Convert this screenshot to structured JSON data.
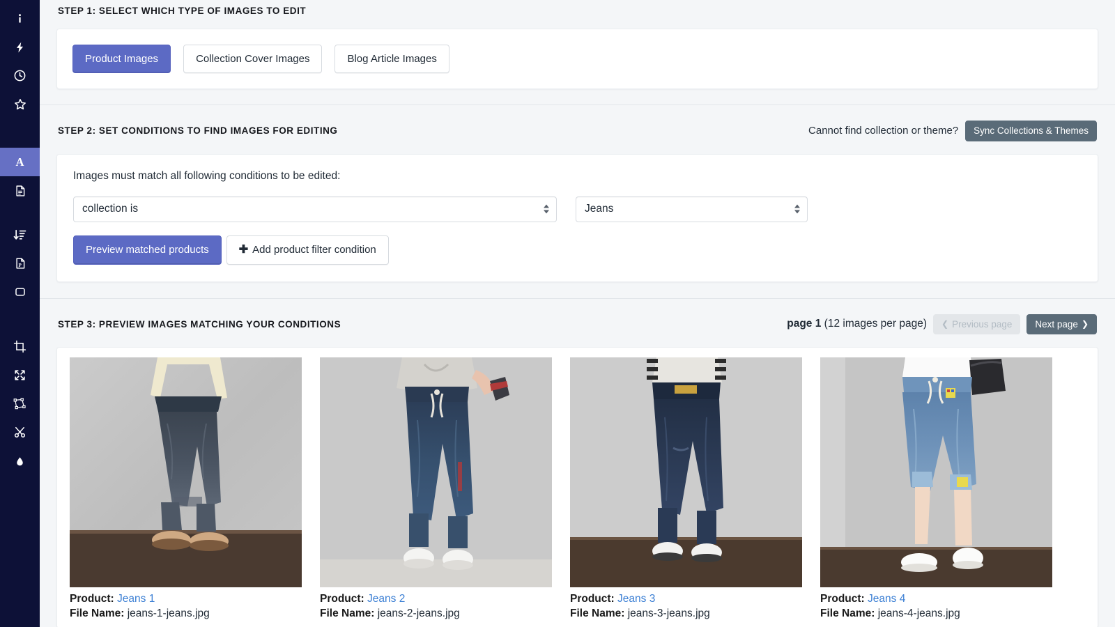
{
  "sidebar": {
    "items": [
      {
        "icon": "info-icon",
        "active": false
      },
      {
        "icon": "bolt-icon",
        "active": false
      },
      {
        "icon": "clock-icon",
        "active": false
      },
      {
        "icon": "star-icon",
        "active": false
      },
      {
        "icon": "text-a-icon",
        "active": true
      },
      {
        "icon": "document-icon",
        "active": false
      },
      {
        "icon": "sort-descending-icon",
        "active": false
      },
      {
        "icon": "pdf-file-icon",
        "active": false
      },
      {
        "icon": "rounded-rect-icon",
        "active": false
      },
      {
        "icon": "crop-icon",
        "active": false
      },
      {
        "icon": "resize-arrows-icon",
        "active": false
      },
      {
        "icon": "transform-icon",
        "active": false
      },
      {
        "icon": "scissors-icon",
        "active": false
      },
      {
        "icon": "droplet-icon",
        "active": false
      }
    ]
  },
  "step1": {
    "title": "STEP 1: SELECT WHICH TYPE OF IMAGES TO EDIT",
    "options": [
      {
        "label": "Product Images",
        "selected": true
      },
      {
        "label": "Collection Cover Images",
        "selected": false
      },
      {
        "label": "Blog Article Images",
        "selected": false
      }
    ]
  },
  "step2": {
    "title": "STEP 2: SET CONDITIONS TO FIND IMAGES FOR EDITING",
    "hint_text": "Cannot find collection or theme?",
    "sync_button": "Sync Collections & Themes",
    "conditions_label": "Images must match all following conditions to be edited:",
    "condition_field": "collection is",
    "condition_value": "Jeans",
    "preview_button": "Preview matched products",
    "add_condition_button": "Add product filter condition",
    "add_condition_icon": "plus-icon"
  },
  "step3": {
    "title": "STEP 3: PREVIEW IMAGES MATCHING YOUR CONDITIONS",
    "page_label": "page 1",
    "page_meta": "(12 images per page)",
    "previous_button": "Previous page",
    "next_button": "Next page",
    "previous_icon": "chevron-left-icon",
    "next_icon": "chevron-right-icon",
    "previous_disabled": true,
    "product_key": "Product:",
    "filename_key": "File Name:",
    "items": [
      {
        "product": "Jeans 1",
        "file_name": "jeans-1-jeans.jpg"
      },
      {
        "product": "Jeans 2",
        "file_name": "jeans-2-jeans.jpg"
      },
      {
        "product": "Jeans 3",
        "file_name": "jeans-3-jeans.jpg"
      },
      {
        "product": "Jeans 4",
        "file_name": "jeans-4-jeans.jpg"
      }
    ]
  },
  "colors": {
    "accent": "#5c6ac4",
    "sidebar": "#0d1137",
    "sidebar_active": "#6670c4",
    "page_bg": "#f4f6f8",
    "slate_button": "#5a6b78",
    "link": "#3b7fd4"
  }
}
